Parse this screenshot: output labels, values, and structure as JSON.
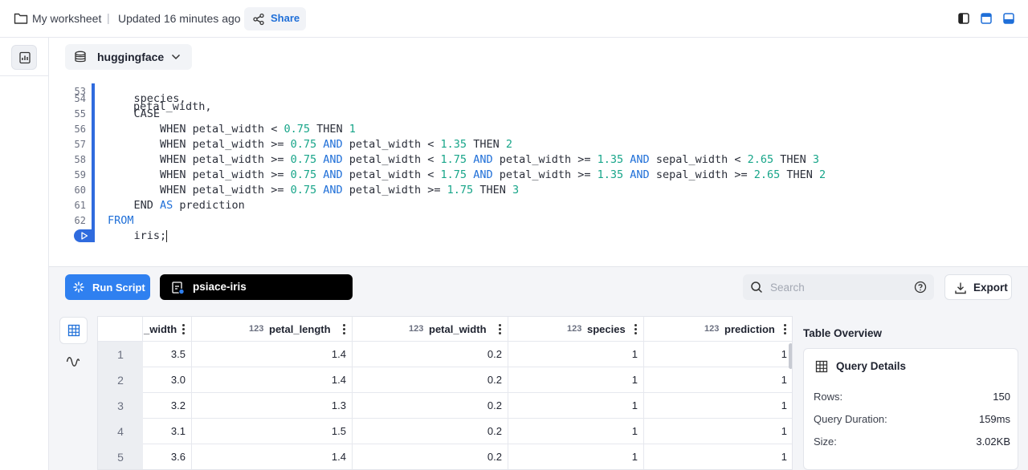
{
  "header": {
    "worksheet_name": "My worksheet",
    "separator": "|",
    "updated": "Updated 16 minutes ago",
    "share_label": "Share"
  },
  "database": {
    "name": "huggingface"
  },
  "editor": {
    "partial_line_number": "53",
    "partial_line_text": "petal_width,",
    "lines": [
      {
        "n": "54",
        "text": "    species,"
      },
      {
        "n": "55",
        "text": "    CASE"
      },
      {
        "n": "56",
        "text": "        WHEN petal_width < 0.75 THEN 1"
      },
      {
        "n": "57",
        "text": "        WHEN petal_width >= 0.75 AND petal_width < 1.35 THEN 2"
      },
      {
        "n": "58",
        "text": "        WHEN petal_width >= 0.75 AND petal_width < 1.75 AND petal_width >= 1.35 AND sepal_width < 2.65 THEN 3"
      },
      {
        "n": "59",
        "text": "        WHEN petal_width >= 0.75 AND petal_width < 1.75 AND petal_width >= 1.35 AND sepal_width >= 2.65 THEN 2"
      },
      {
        "n": "60",
        "text": "        WHEN petal_width >= 0.75 AND petal_width >= 1.75 THEN 3"
      },
      {
        "n": "61",
        "text": "    END AS prediction"
      },
      {
        "n": "62",
        "text": "FROM"
      },
      {
        "n": "",
        "text": "    iris;"
      }
    ]
  },
  "toolbar": {
    "run_label": "Run Script",
    "query_name": "psiace-iris",
    "search_placeholder": "Search",
    "export_label": "Export"
  },
  "grid": {
    "type_tag": "123",
    "columns": [
      "_width",
      "petal_length",
      "petal_width",
      "species",
      "prediction"
    ],
    "rows": [
      {
        "n": "1",
        "cells": [
          "3.5",
          "1.4",
          "0.2",
          "1",
          "1"
        ]
      },
      {
        "n": "2",
        "cells": [
          "3.0",
          "1.4",
          "0.2",
          "1",
          "1"
        ]
      },
      {
        "n": "3",
        "cells": [
          "3.2",
          "1.3",
          "0.2",
          "1",
          "1"
        ]
      },
      {
        "n": "4",
        "cells": [
          "3.1",
          "1.5",
          "0.2",
          "1",
          "1"
        ]
      },
      {
        "n": "5",
        "cells": [
          "3.6",
          "1.4",
          "0.2",
          "1",
          "1"
        ]
      }
    ]
  },
  "overview": {
    "title": "Table Overview",
    "card_title": "Query Details",
    "rows": [
      {
        "k": "Rows:",
        "v": "150"
      },
      {
        "k": "Query Duration:",
        "v": "159ms"
      },
      {
        "k": "Size:",
        "v": "3.02KB"
      }
    ]
  },
  "colors": {
    "accent": "#2f80f0",
    "keyword": "#1f6fd8",
    "number": "#17a589",
    "name_field_bg": "#000000"
  },
  "icons": [
    "folder-icon",
    "share-icon",
    "layout-left-icon",
    "layout-top-icon",
    "layout-bottom-icon",
    "chart-doc-icon",
    "database-icon",
    "chevron-down-icon",
    "play-icon",
    "run-sparkle-icon",
    "query-file-icon",
    "search-icon",
    "help-icon",
    "download-icon",
    "grid-icon",
    "wave-icon",
    "table-icon"
  ]
}
